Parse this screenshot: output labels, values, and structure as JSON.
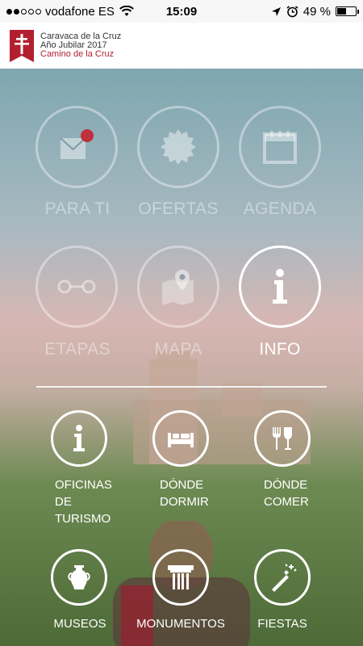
{
  "status_bar": {
    "carrier": "vodafone ES",
    "time": "15:09",
    "battery_percent": "49 %",
    "battery_level": 0.49
  },
  "brand": {
    "line1": "Caravaca de la Cruz",
    "line2": "Año Jubilar 2017",
    "line3": "Camino de la Cruz",
    "accent_color": "#b22030"
  },
  "main_menu": [
    {
      "label": "PARA TI",
      "icon": "mail-notification-icon",
      "active": false
    },
    {
      "label": "OFERTAS",
      "icon": "badge-seal-icon",
      "active": false
    },
    {
      "label": "AGENDA",
      "icon": "calendar-icon",
      "active": false
    },
    {
      "label": "ETAPAS",
      "icon": "route-stages-icon",
      "active": false
    },
    {
      "label": "MAPA",
      "icon": "map-pin-icon",
      "active": false
    },
    {
      "label": "INFO",
      "icon": "info-icon",
      "active": true
    }
  ],
  "info_menu": [
    {
      "lines": [
        "OFICINAS",
        "DE",
        "TURISMO"
      ],
      "icon": "info-icon"
    },
    {
      "lines": [
        "DÓNDE",
        "DORMIR"
      ],
      "icon": "bed-icon"
    },
    {
      "lines": [
        "DÓNDE",
        "COMER"
      ],
      "icon": "fork-glass-icon"
    },
    {
      "lines": [
        "MUSEOS"
      ],
      "icon": "vase-icon"
    },
    {
      "lines": [
        "MONUMENTOS"
      ],
      "icon": "column-icon"
    },
    {
      "lines": [
        "FIESTAS"
      ],
      "icon": "firework-icon"
    }
  ]
}
